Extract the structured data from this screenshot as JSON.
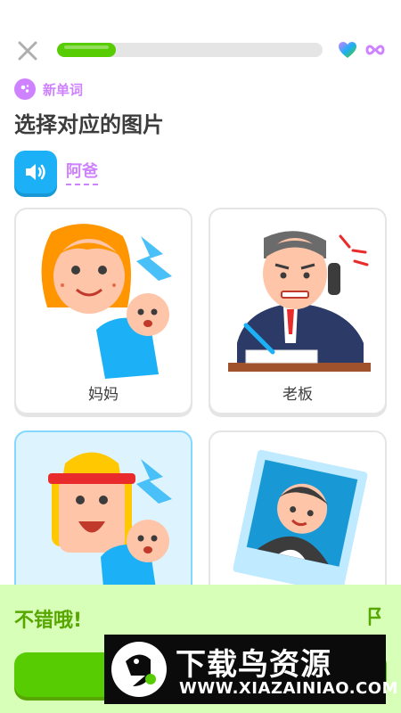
{
  "header": {
    "progress": 0.22,
    "close_icon": "close-icon",
    "hearts_icon": "heart-icon",
    "hearts_value_icon": "infinity-icon",
    "accent": "#58cc02"
  },
  "badge": {
    "icon": "sparkle-icon",
    "label": "新单词",
    "color": "#ce82ff"
  },
  "title": "选择对应的图片",
  "prompt": {
    "icon": "speaker-icon",
    "word": "阿爸"
  },
  "choices": [
    {
      "label": "妈妈",
      "selected": false
    },
    {
      "label": "老板",
      "selected": false
    },
    {
      "label": "",
      "selected": true
    },
    {
      "label": "",
      "selected": false
    }
  ],
  "feedback": {
    "text": "不错哦!",
    "icon": "flag-icon",
    "color": "#58a700",
    "bg": "#d7ffb8"
  },
  "watermark": {
    "title": "下载鸟资源",
    "url": "WWW.XIAZAINIAO.COM"
  }
}
